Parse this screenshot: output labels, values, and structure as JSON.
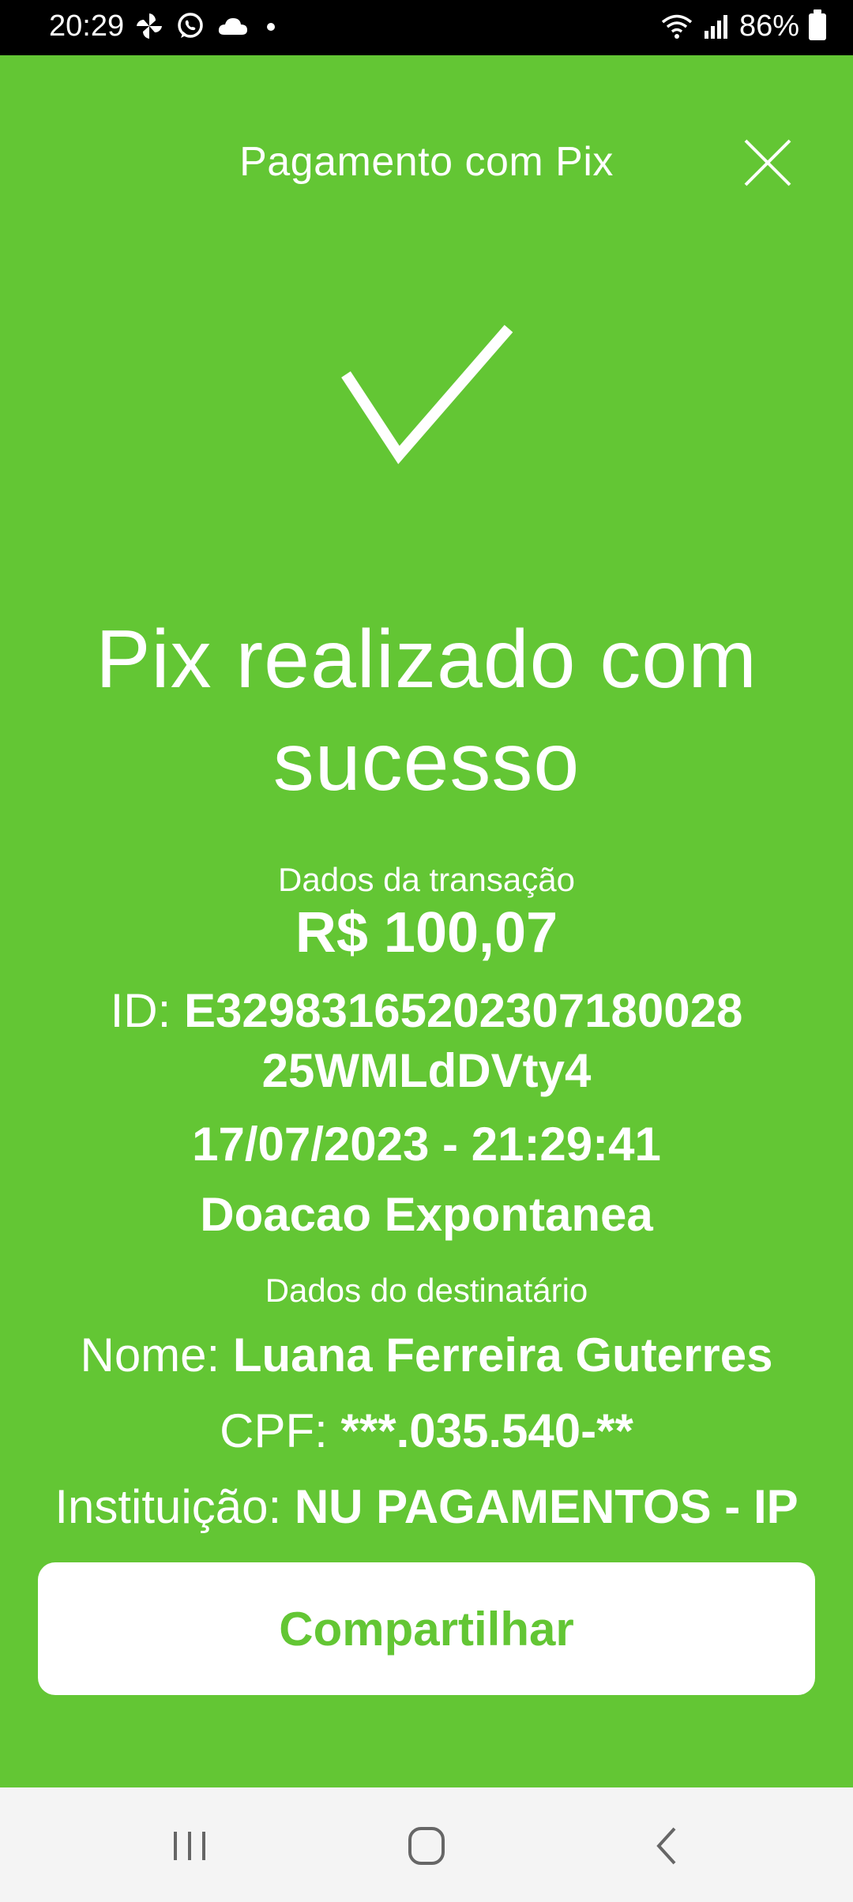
{
  "status_bar": {
    "time": "20:29",
    "battery": "86%",
    "notification_icons": [
      "pinwheel-icon",
      "whatsapp-icon",
      "cloud-icon",
      "dot-icon"
    ],
    "system_icons": [
      "wifi-icon",
      "signal-icon",
      "battery-icon"
    ]
  },
  "header": {
    "title": "Pagamento com Pix",
    "close_icon": "close-icon"
  },
  "success": {
    "icon": "checkmark-icon",
    "title": "Pix realizado com sucesso"
  },
  "transaction": {
    "section_label": "Dados da transação",
    "amount": "R$ 100,07",
    "id_label": "ID:",
    "id_value": "E32983165202307180028 25WMLdDVty4",
    "datetime": "17/07/2023 - 21:29:41",
    "description": "Doacao Expontanea"
  },
  "recipient": {
    "section_label": "Dados do destinatário",
    "name_label": "Nome:",
    "name_value": "Luana Ferreira Guterres",
    "cpf_label": "CPF:",
    "cpf_value": "***.035.540-**",
    "institution_label": "Instituição:",
    "institution_value": "NU PAGAMENTOS - IP"
  },
  "actions": {
    "share_label": "Compartilhar"
  },
  "nav_bar": {
    "recents_icon": "recents-icon",
    "home_icon": "home-icon",
    "back_icon": "back-icon"
  },
  "colors": {
    "brand_green": "#63c634",
    "status_bar": "#000000",
    "nav_bar": "#f4f4f4",
    "button_bg": "#ffffff"
  }
}
